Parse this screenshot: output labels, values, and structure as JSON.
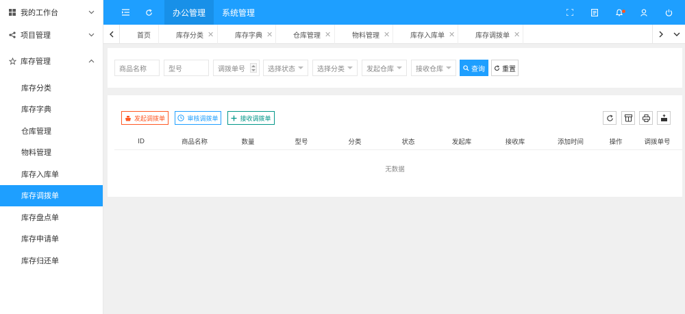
{
  "sidebar": {
    "groups": [
      {
        "label": "我的工作台",
        "icon": "windows-icon",
        "expanded": false
      },
      {
        "label": "项目管理",
        "icon": "share-icon",
        "expanded": false
      },
      {
        "label": "库存管理",
        "icon": "star-icon",
        "expanded": true
      }
    ],
    "items": [
      {
        "label": "库存分类",
        "active": false
      },
      {
        "label": "库存字典",
        "active": false
      },
      {
        "label": "仓库管理",
        "active": false
      },
      {
        "label": "物料管理",
        "active": false
      },
      {
        "label": "库存入库单",
        "active": false
      },
      {
        "label": "库存调拨单",
        "active": true
      },
      {
        "label": "库存盘点单",
        "active": false
      },
      {
        "label": "库存申请单",
        "active": false
      },
      {
        "label": "库存归还单",
        "active": false
      }
    ]
  },
  "header": {
    "menus": [
      {
        "label": "办公管理",
        "active": true
      },
      {
        "label": "系统管理",
        "active": false
      }
    ],
    "icons_left": [
      "menu-fold-icon",
      "refresh-icon"
    ],
    "icons_right": [
      "fullscreen-icon",
      "note-icon",
      "bell-icon",
      "user-icon",
      "power-icon"
    ]
  },
  "tabs": [
    {
      "label": "首页",
      "closable": false,
      "active": false
    },
    {
      "label": "库存分类",
      "closable": true,
      "active": false
    },
    {
      "label": "库存字典",
      "closable": true,
      "active": false
    },
    {
      "label": "仓库管理",
      "closable": true,
      "active": false
    },
    {
      "label": "物料管理",
      "closable": true,
      "active": false
    },
    {
      "label": "库存入库单",
      "closable": true,
      "active": false
    },
    {
      "label": "库存调拨单",
      "closable": true,
      "active": true
    }
  ],
  "search": {
    "fields": [
      {
        "placeholder": "商品名称",
        "kind": "text"
      },
      {
        "placeholder": "型号",
        "kind": "text"
      },
      {
        "placeholder": "调拨单号",
        "kind": "number"
      },
      {
        "placeholder": "选择状态",
        "kind": "select"
      },
      {
        "placeholder": "选择分类",
        "kind": "select"
      },
      {
        "placeholder": "发起仓库",
        "kind": "select"
      },
      {
        "placeholder": "接收仓库",
        "kind": "select"
      }
    ],
    "query_label": "查询",
    "reset_label": "重置"
  },
  "toolbar": {
    "buttons": [
      {
        "label": "发起调拨单",
        "color": "#ff5722"
      },
      {
        "label": "审核调拨单",
        "color": "#1e9fff"
      },
      {
        "label": "接收调拨单",
        "color": "#009688"
      }
    ],
    "tools": [
      "refresh-icon",
      "columns-icon",
      "print-icon",
      "export-icon"
    ]
  },
  "table": {
    "columns": [
      "ID",
      "商品名称",
      "数量",
      "型号",
      "分类",
      "状态",
      "发起库",
      "接收库",
      "添加时间",
      "操作",
      "调拨单号"
    ],
    "empty_text": "无数据"
  },
  "colors": {
    "primary": "#1e9fff",
    "danger": "#ff5722",
    "success": "#009688"
  }
}
